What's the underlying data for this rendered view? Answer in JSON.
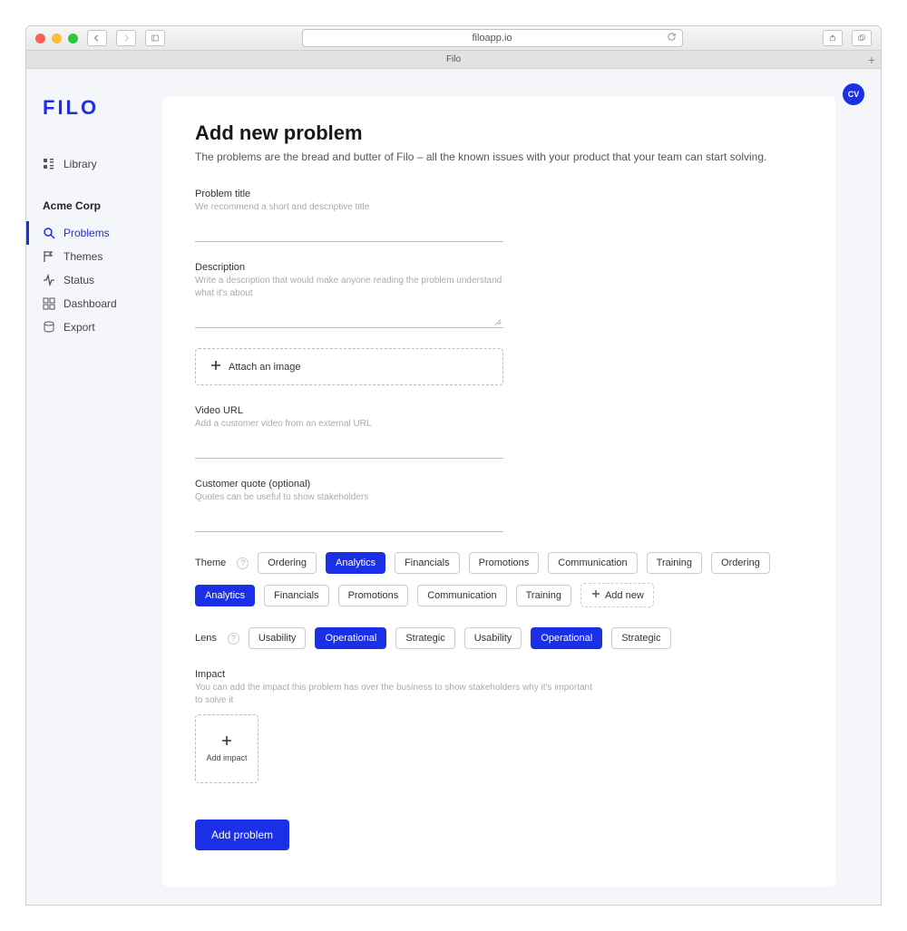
{
  "browser": {
    "url": "filoapp.io",
    "tab": "Filo"
  },
  "logo": "FILO",
  "avatar": "CV",
  "sidebar": {
    "library": "Library",
    "org": "Acme Corp",
    "items": [
      {
        "label": "Problems"
      },
      {
        "label": "Themes"
      },
      {
        "label": "Status"
      },
      {
        "label": "Dashboard"
      },
      {
        "label": "Export"
      }
    ]
  },
  "page": {
    "title": "Add new problem",
    "subtitle": "The problems are the bread and butter of Filo – all the known issues with your product that your team can start solving."
  },
  "fields": {
    "problem_title": {
      "label": "Problem title",
      "hint": "We recommend a short and descriptive title"
    },
    "description": {
      "label": "Description",
      "hint": "Write a description that would make anyone reading the problem understand what it's about"
    },
    "attach": "Attach an image",
    "video": {
      "label": "Video URL",
      "hint": "Add a customer video from an external URL"
    },
    "quote": {
      "label": "Customer quote (optional)",
      "hint": "Quotes can be useful to show stakeholders"
    },
    "theme": {
      "label": "Theme",
      "add_new": "Add new"
    },
    "lens": {
      "label": "Lens"
    },
    "impact": {
      "label": "Impact",
      "hint": "You can add the impact this problem has over the business to show stakeholders why it's important to solve it",
      "add": "Add impact"
    }
  },
  "themes": [
    {
      "label": "Ordering",
      "selected": false
    },
    {
      "label": "Analytics",
      "selected": true
    },
    {
      "label": "Financials",
      "selected": false
    },
    {
      "label": "Promotions",
      "selected": false
    },
    {
      "label": "Communication",
      "selected": false
    },
    {
      "label": "Training",
      "selected": false
    }
  ],
  "lenses": [
    {
      "label": "Usability",
      "selected": false
    },
    {
      "label": "Operational",
      "selected": true
    },
    {
      "label": "Strategic",
      "selected": false
    }
  ],
  "submit": "Add problem"
}
